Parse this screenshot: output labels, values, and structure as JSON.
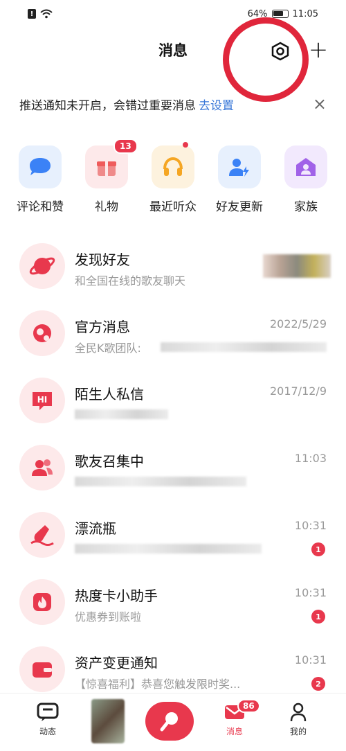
{
  "status_bar": {
    "battery": "64%",
    "time": "11:05",
    "sim": "!"
  },
  "header": {
    "title": "消息",
    "plus": "+"
  },
  "notify": {
    "text": "推送通知未开启，会错过重要消息",
    "link": "去设置",
    "close": "×"
  },
  "shortcuts": [
    {
      "label": "评论和赞",
      "icon": "chat-bubble-icon",
      "color": "#3b82f6",
      "bg": "#e7f0fd"
    },
    {
      "label": "礼物",
      "icon": "gift-icon",
      "color": "#ef5b5b",
      "bg": "#fde9ea",
      "badge": "13"
    },
    {
      "label": "最近听众",
      "icon": "headphones-icon",
      "color": "#f5a623",
      "bg": "#fdf2de"
    },
    {
      "label": "好友更新",
      "icon": "user-lightning-icon",
      "color": "#3b82f6",
      "bg": "#e7f0fd"
    },
    {
      "label": "家族",
      "icon": "home-person-icon",
      "color": "#a162e8",
      "bg": "#f2e9fd"
    }
  ],
  "messages": [
    {
      "title": "发现好友",
      "sub": "和全国在线的歌友聊天",
      "time": "",
      "badge": "",
      "icon": "planet-icon"
    },
    {
      "title": "官方消息",
      "sub": "全民K歌团队:",
      "time": "2022/5/29",
      "badge": "",
      "icon": "official-icon"
    },
    {
      "title": "陌生人私信",
      "sub": "",
      "time": "2017/12/9",
      "badge": "",
      "icon": "hi-icon"
    },
    {
      "title": "歌友召集中",
      "sub": "",
      "time": "11:03",
      "badge": "",
      "icon": "people-icon"
    },
    {
      "title": "漂流瓶",
      "sub": "",
      "time": "10:31",
      "badge": "1",
      "icon": "bottle-icon"
    },
    {
      "title": "热度卡小助手",
      "sub": "优惠券到账啦",
      "time": "10:31",
      "badge": "1",
      "icon": "fire-icon"
    },
    {
      "title": "资产变更通知",
      "sub": "【惊喜福利】恭喜您触发限时奖...",
      "time": "10:31",
      "badge": "2",
      "icon": "wallet-icon"
    }
  ],
  "nav": {
    "feed_label": "动态",
    "message_label": "消息",
    "message_badge": "86",
    "me_label": "我的"
  },
  "colors": {
    "accent": "#e8384d",
    "link": "#3a78d8",
    "annotation_circle": "#e0263b"
  }
}
